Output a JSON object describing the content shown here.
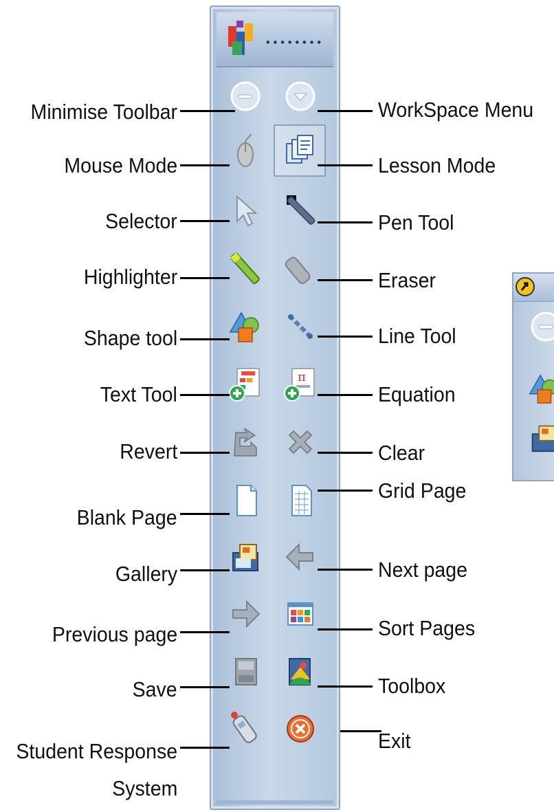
{
  "toolbar": {
    "header_grip": "∙∙∙∙∙∙∙∙"
  },
  "labels_left": [
    {
      "text": "Minimise Toolbar"
    },
    {
      "text": "Mouse Mode"
    },
    {
      "text": "Selector"
    },
    {
      "text": "Highlighter"
    },
    {
      "text": "Shape tool"
    },
    {
      "text": "Text Tool"
    },
    {
      "text": "Revert"
    },
    {
      "text": "Blank Page"
    },
    {
      "text": "Gallery"
    },
    {
      "text": "Previous page"
    },
    {
      "text": "Save"
    },
    {
      "text": "Student Response"
    },
    {
      "text": "System"
    }
  ],
  "labels_right": [
    {
      "text": "WorkSpace Menu"
    },
    {
      "text": "Lesson Mode"
    },
    {
      "text": "Pen Tool"
    },
    {
      "text": "Eraser"
    },
    {
      "text": "Line Tool"
    },
    {
      "text": "Equation"
    },
    {
      "text": "Clear"
    },
    {
      "text": "Grid Page"
    },
    {
      "text": "Next page"
    },
    {
      "text": "Sort Pages"
    },
    {
      "text": "Toolbox"
    },
    {
      "text": "Exit"
    }
  ],
  "icons": {
    "left": [
      "minimise-icon",
      "mouse-icon",
      "selector-arrow-icon",
      "highlighter-icon",
      "shape-icon",
      "text-tool-icon",
      "revert-icon",
      "blank-page-icon",
      "gallery-icon",
      "previous-page-icon",
      "save-icon",
      "student-response-icon"
    ],
    "right": [
      "workspace-menu-icon",
      "lesson-mode-icon",
      "pen-icon",
      "eraser-icon",
      "line-tool-icon",
      "equation-icon",
      "clear-icon",
      "grid-page-icon",
      "next-page-icon",
      "sort-pages-icon",
      "toolbox-icon",
      "exit-icon"
    ]
  },
  "colors": {
    "toolbar_bg": "#c9d8e9",
    "toolbar_border": "#8ea6c2",
    "label_text": "#111111"
  }
}
